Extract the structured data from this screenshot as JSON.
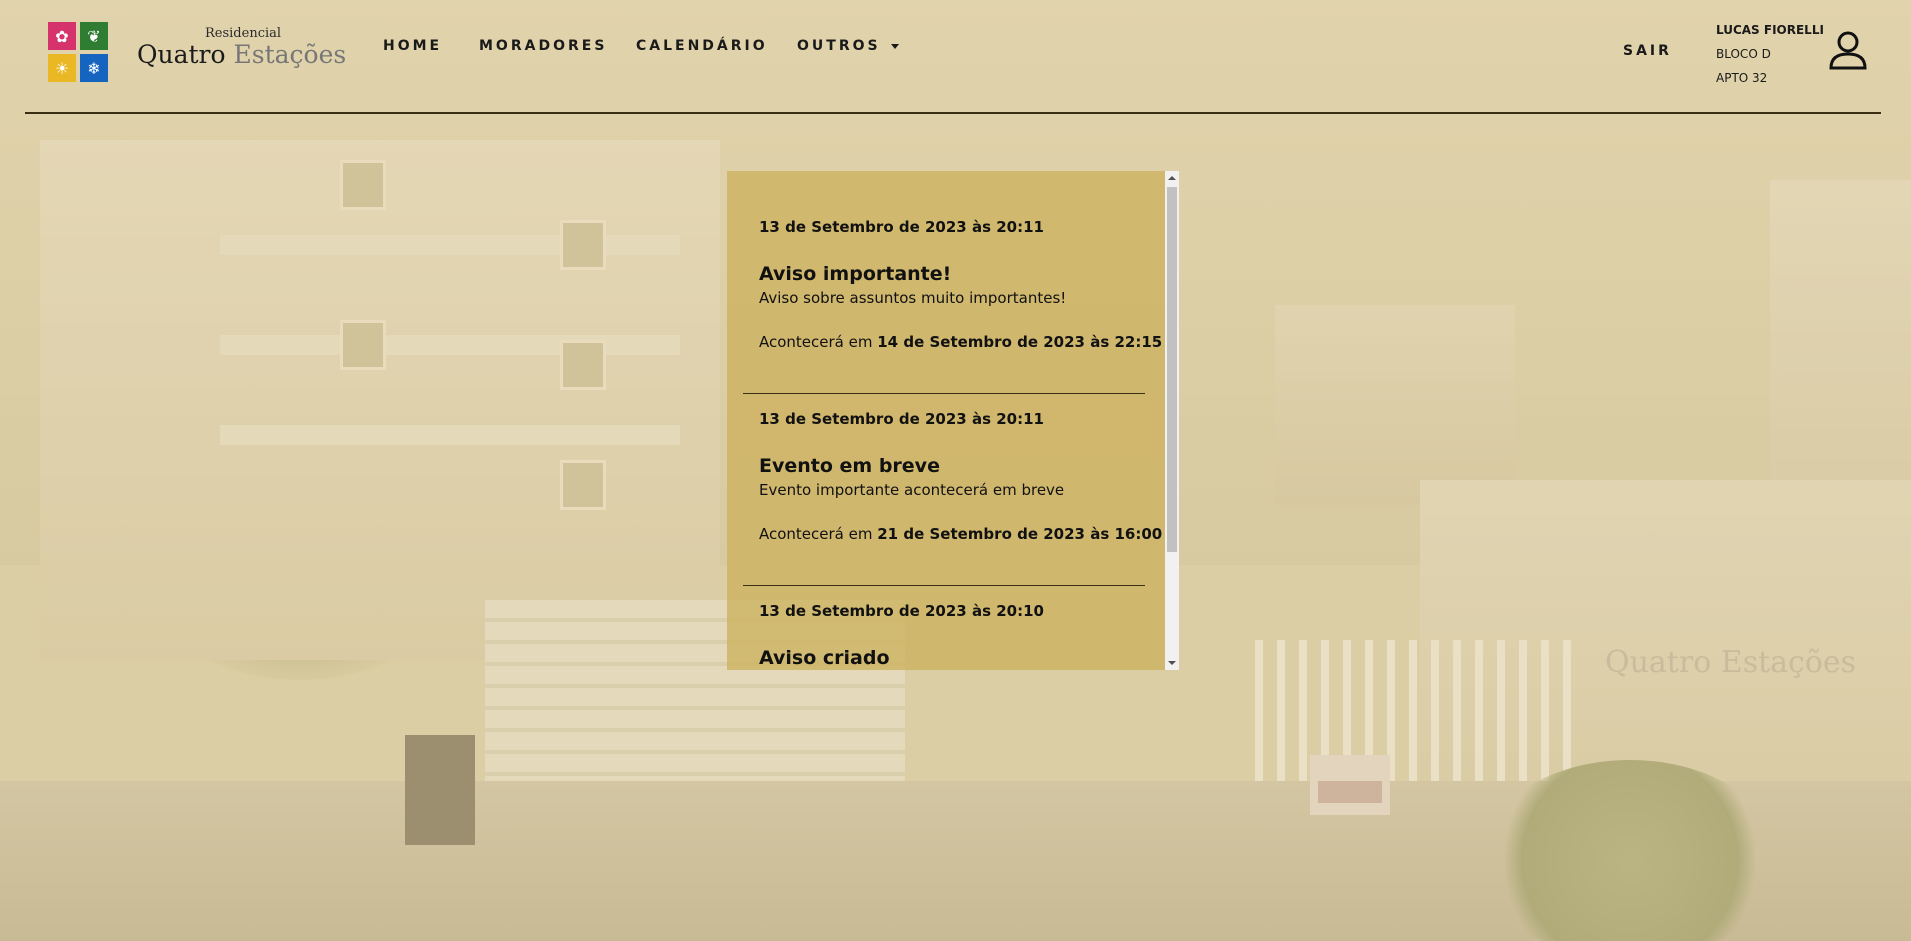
{
  "brand": {
    "small": "Residencial",
    "main_1": "Quatro",
    "main_2": "Estações"
  },
  "nav": {
    "home": "HOME",
    "moradores": "MORADORES",
    "calendario": "CALENDÁRIO",
    "outros": "OUTROS"
  },
  "user": {
    "logout": "SAIR",
    "name": "LUCAS FIORELLI",
    "bloco": "BLOCO D",
    "apto": "APTO 32"
  },
  "background": {
    "wall_sign": "Quatro Estações"
  },
  "feed": {
    "items": [
      {
        "date": "13 de Setembro de 2023 às 20:11",
        "title": "Aviso importante!",
        "desc": "Aviso sobre assuntos muito importantes!",
        "when_prefix": "Acontecerá em ",
        "when_date": "14 de Setembro de 2023 às 22:15"
      },
      {
        "date": "13 de Setembro de 2023 às 20:11",
        "title": "Evento em breve",
        "desc": "Evento importante acontecerá em breve",
        "when_prefix": "Acontecerá em ",
        "when_date": "21 de Setembro de 2023 às 16:00"
      },
      {
        "date": "13 de Setembro de 2023 às 20:10",
        "title": "Aviso criado"
      }
    ]
  }
}
